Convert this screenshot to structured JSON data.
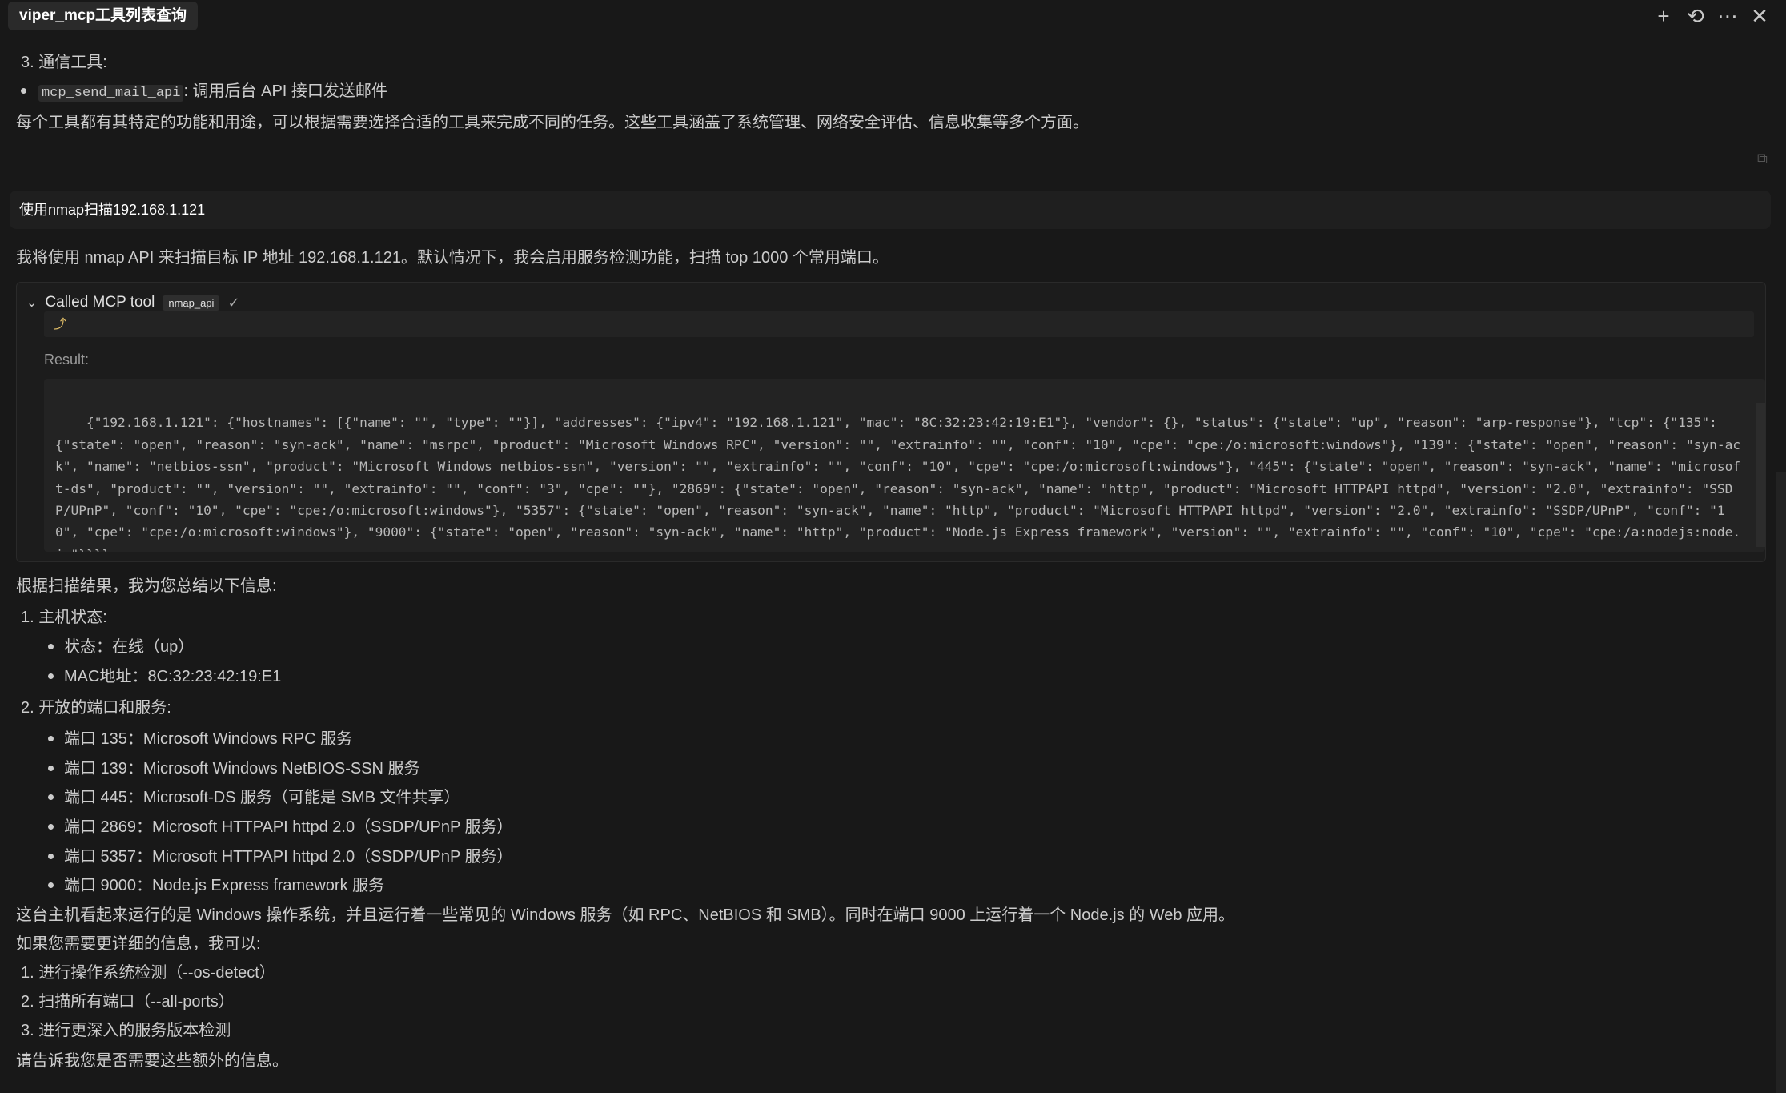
{
  "window": {
    "title": "viper_mcp工具列表查询",
    "actions": [
      {
        "name": "plus-icon",
        "glyph": "+"
      },
      {
        "name": "history-icon",
        "glyph": "⟲"
      },
      {
        "name": "more-icon",
        "glyph": "⋯"
      },
      {
        "name": "close-icon",
        "glyph": "✕"
      }
    ]
  },
  "prev_response": {
    "section3": "3. 通信工具:",
    "mail_tool_code": "mcp_send_mail_api",
    "mail_tool_desc": ": 调用后台 API 接口发送邮件",
    "summary": "每个工具都有其特定的功能和用途，可以根据需要选择合适的工具来完成不同的任务。这些工具涵盖了系统管理、网络安全评估、信息收集等多个方面。"
  },
  "user_message": "使用nmap扫描192.168.1.121",
  "assistant": {
    "intro": "我将使用 nmap API 来扫描目标 IP 地址 192.168.1.121。默认情况下，我会启用服务检测功能，扫描 top 1000 个常用端口。",
    "tool_call": {
      "label": "Called MCP tool",
      "tool_name": "nmap_api",
      "status_icon": "✓",
      "param_preview": "⤴",
      "result_label": "Result:",
      "result_text": "{\"192.168.1.121\": {\"hostnames\": [{\"name\": \"\", \"type\": \"\"}], \"addresses\": {\"ipv4\": \"192.168.1.121\", \"mac\": \"8C:32:23:42:19:E1\"}, \"vendor\": {}, \"status\": {\"state\": \"up\", \"reason\": \"arp-response\"}, \"tcp\": {\"135\": {\"state\": \"open\", \"reason\": \"syn-ack\", \"name\": \"msrpc\", \"product\": \"Microsoft Windows RPC\", \"version\": \"\", \"extrainfo\": \"\", \"conf\": \"10\", \"cpe\": \"cpe:/o:microsoft:windows\"}, \"139\": {\"state\": \"open\", \"reason\": \"syn-ack\", \"name\": \"netbios-ssn\", \"product\": \"Microsoft Windows netbios-ssn\", \"version\": \"\", \"extrainfo\": \"\", \"conf\": \"10\", \"cpe\": \"cpe:/o:microsoft:windows\"}, \"445\": {\"state\": \"open\", \"reason\": \"syn-ack\", \"name\": \"microsoft-ds\", \"product\": \"\", \"version\": \"\", \"extrainfo\": \"\", \"conf\": \"3\", \"cpe\": \"\"}, \"2869\": {\"state\": \"open\", \"reason\": \"syn-ack\", \"name\": \"http\", \"product\": \"Microsoft HTTPAPI httpd\", \"version\": \"2.0\", \"extrainfo\": \"SSDP/UPnP\", \"conf\": \"10\", \"cpe\": \"cpe:/o:microsoft:windows\"}, \"5357\": {\"state\": \"open\", \"reason\": \"syn-ack\", \"name\": \"http\", \"product\": \"Microsoft HTTPAPI httpd\", \"version\": \"2.0\", \"extrainfo\": \"SSDP/UPnP\", \"conf\": \"10\", \"cpe\": \"cpe:/o:microsoft:windows\"}, \"9000\": {\"state\": \"open\", \"reason\": \"syn-ack\", \"name\": \"http\", \"product\": \"Node.js Express framework\", \"version\": \"\", \"extrainfo\": \"\", \"conf\": \"10\", \"cpe\": \"cpe:/a:nodejs:node.js\"}}}}"
    },
    "summary_intro": "根据扫描结果，我为您总结以下信息:",
    "host_status_title": "1. 主机状态:",
    "host_status_items": [
      "状态：在线（up）",
      "MAC地址：8C:32:23:42:19:E1"
    ],
    "ports_title": "2. 开放的端口和服务:",
    "port_items": [
      "端口 135：Microsoft Windows RPC 服务",
      "端口 139：Microsoft Windows NetBIOS-SSN 服务",
      "端口 445：Microsoft-DS 服务（可能是 SMB 文件共享）",
      "端口 2869：Microsoft HTTPAPI httpd 2.0（SSDP/UPnP 服务）",
      "端口 5357：Microsoft HTTPAPI httpd 2.0（SSDP/UPnP 服务）",
      "端口 9000：Node.js Express framework 服务"
    ],
    "conclusion": "这台主机看起来运行的是 Windows 操作系统，并且运行着一些常见的 Windows 服务（如 RPC、NetBIOS 和 SMB）。同时在端口 9000 上运行着一个 Node.js 的 Web 应用。",
    "more_info_intro": "如果您需要更详细的信息，我可以:",
    "options": [
      "1. 进行操作系统检测（--os-detect）",
      "2. 扫描所有端口（--all-ports）",
      "3. 进行更深入的服务版本检测"
    ],
    "closing": "请告诉我您是否需要这些额外的信息。"
  },
  "icons": {
    "copy": "⧉"
  }
}
